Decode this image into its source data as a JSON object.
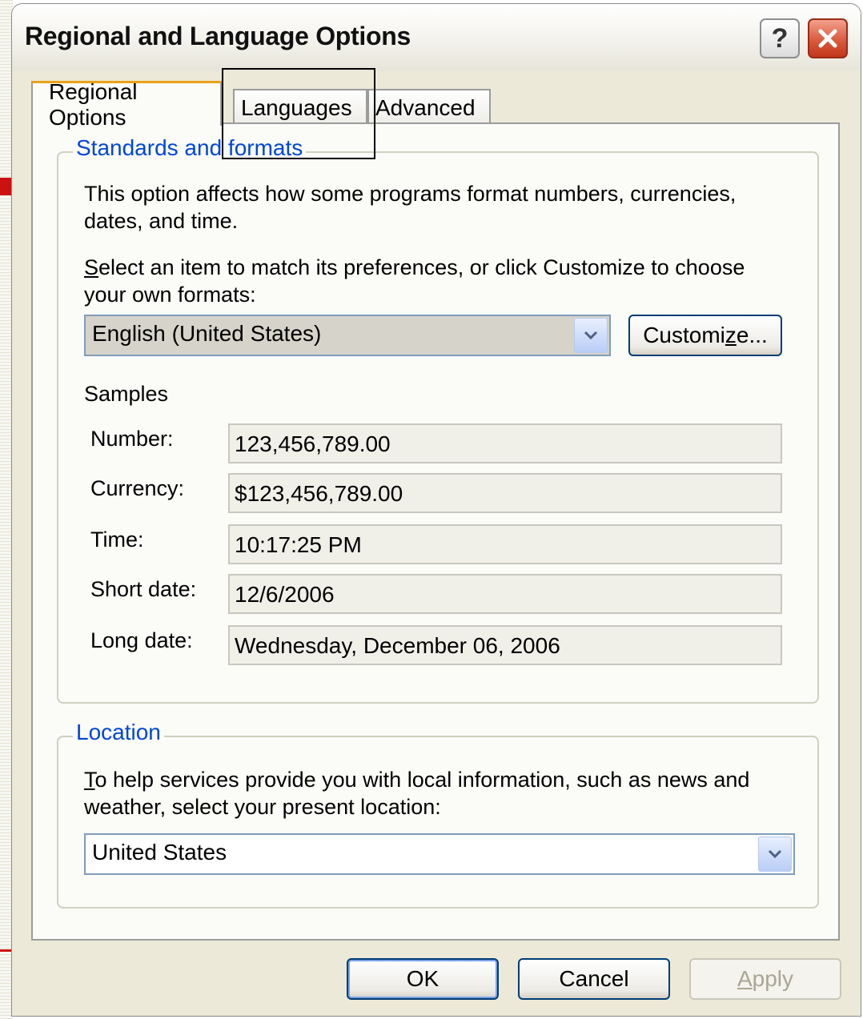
{
  "window": {
    "title": "Regional and Language Options",
    "help_glyph": "?",
    "close_glyph": "✕"
  },
  "tabs": [
    {
      "label": "Regional Options",
      "active": true
    },
    {
      "label": "Languages",
      "active": false
    },
    {
      "label": "Advanced",
      "active": false
    }
  ],
  "standards": {
    "legend": "Standards and formats",
    "description": "This option affects how some programs format numbers, currencies, dates, and time.",
    "select_prompt_key": "S",
    "select_prompt_rest": "elect an item to match its preferences, or click Customize to choose your own formats:",
    "format_value": "English (United States)",
    "customize_pre": "Customi",
    "customize_key": "z",
    "customize_post": "e...",
    "samples_label": "Samples",
    "samples": [
      {
        "label": "Number:",
        "value": "123,456,789.00"
      },
      {
        "label": "Currency:",
        "value": "$123,456,789.00"
      },
      {
        "label": "Time:",
        "value": "10:17:25 PM"
      },
      {
        "label": "Short date:",
        "value": "12/6/2006"
      },
      {
        "label": "Long date:",
        "value": "Wednesday, December 06, 2006"
      }
    ]
  },
  "location": {
    "legend": "Location",
    "description_key": "T",
    "description_rest": "o help services provide you with local information, such as news and weather, select your present location:",
    "value": "United States"
  },
  "buttons": {
    "ok": "OK",
    "cancel": "Cancel",
    "apply_key": "A",
    "apply_rest": "pply"
  },
  "icons": {
    "dropdown": "chevron-down-icon",
    "help": "help-icon",
    "close": "close-icon"
  },
  "colors": {
    "legend_blue": "#0046d5",
    "close_red": "#d8553a",
    "tab_accent": "#e8a21b"
  }
}
